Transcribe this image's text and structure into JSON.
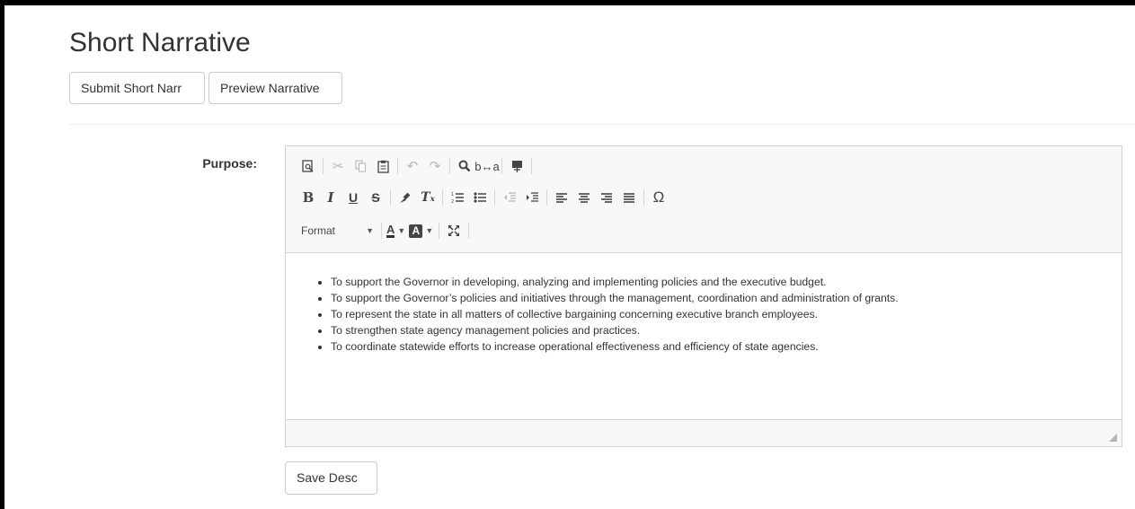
{
  "page": {
    "title": "Short Narrative"
  },
  "actions": {
    "submit_label": "Submit Short Narr",
    "preview_label": "Preview Narrative",
    "save_label": "Save Desc"
  },
  "form": {
    "purpose_label": "Purpose:"
  },
  "editor": {
    "toolbar": {
      "row1": [
        "preview-icon",
        "cut-icon",
        "copy-icon",
        "paste-icon",
        "undo-icon",
        "redo-icon",
        "find-icon",
        "replace-icon",
        "show-blocks-icon"
      ],
      "row2": [
        "bold-icon",
        "italic-icon",
        "underline-icon",
        "strikethrough-icon",
        "copy-format-icon",
        "remove-format-icon",
        "numbered-list-icon",
        "bulleted-list-icon",
        "decrease-indent-icon",
        "increase-indent-icon",
        "align-left-icon",
        "align-center-icon",
        "align-right-icon",
        "justify-icon",
        "special-character-icon"
      ],
      "format_label": "Format",
      "row3": [
        "text-color-icon",
        "background-color-icon",
        "maximize-icon"
      ]
    },
    "content": [
      "To support the Governor in developing, analyzing and implementing policies and the executive budget.",
      "To support the Governor’s policies and initiatives through the management, coordination and administration of grants.",
      "To represent the state in all matters of collective bargaining concerning executive branch employees.",
      "To strengthen state agency management policies and practices.",
      "To coordinate statewide efforts to increase operational effectiveness and efficiency of state agencies."
    ]
  }
}
